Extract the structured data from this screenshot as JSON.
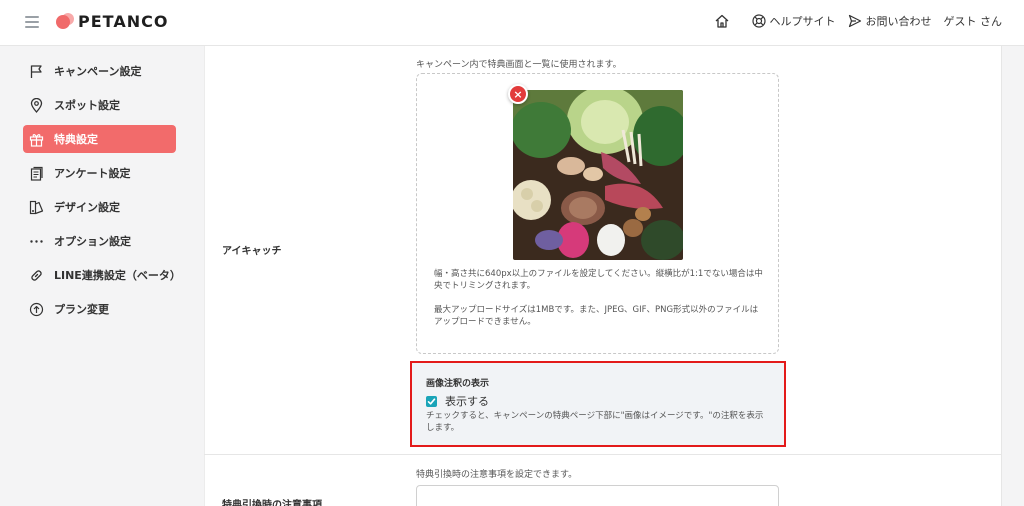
{
  "header": {
    "logo": "PETANCO",
    "links": [
      {
        "label": "ヘルプサイト",
        "icon": "globe-icon"
      },
      {
        "label": "お問い合わせ",
        "icon": "send-icon"
      }
    ],
    "user": "ゲスト さん"
  },
  "sidebar": {
    "items": [
      {
        "label": "キャンペーン設定",
        "icon": "flag-icon",
        "active": false
      },
      {
        "label": "スポット設定",
        "icon": "map-pin-icon",
        "active": false
      },
      {
        "label": "特典設定",
        "icon": "gift-icon",
        "active": true
      },
      {
        "label": "アンケート設定",
        "icon": "clipboard-icon",
        "active": false
      },
      {
        "label": "デザイン設定",
        "icon": "palette-icon",
        "active": false
      },
      {
        "label": "オプション設定",
        "icon": "more-icon",
        "active": false
      },
      {
        "label": "LINE連携設定（ベータ）",
        "icon": "link-icon",
        "active": false
      },
      {
        "label": "プラン変更",
        "icon": "arrow-up-circle-icon",
        "active": false
      }
    ]
  },
  "main": {
    "eyecatch": {
      "label": "アイキャッチ",
      "helper": "キャンペーン内で特典画面と一覧に使用されます。",
      "remove_label": "×",
      "note1": "幅・高さ共に640px以上のファイルを設定してください。縦横比が1:1でない場合は中央でトリミングされます。",
      "note2": "最大アップロードサイズは1MBです。また、JPEG、GIF、PNG形式以外のファイルはアップロードできません。"
    },
    "annotation": {
      "title": "画像注釈の表示",
      "checkbox_label": "表示する",
      "checked": true,
      "description": "チェックすると、キャンペーンの特典ページ下部に\"画像はイメージです。\"の注釈を表示します。"
    },
    "notes": {
      "label": "特典引換時の注意事項",
      "helper": "特典引換時の注意事項を設定できます。",
      "value": ""
    }
  },
  "colors": {
    "accent": "#f26b6b",
    "checkbox": "#1aa4b8",
    "highlight_border": "#e31a1a"
  }
}
